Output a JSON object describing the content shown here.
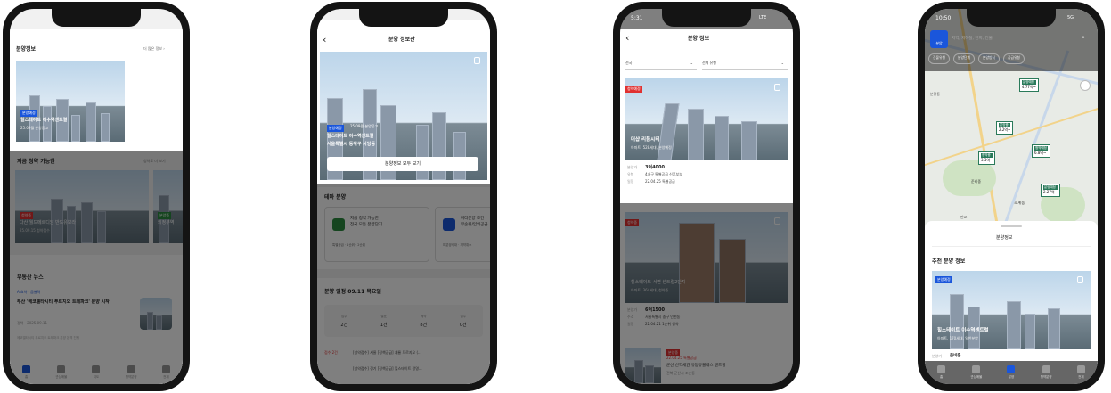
{
  "phone1": {
    "section_title": "분양정보",
    "more_link": "더 많은 정보",
    "hero": {
      "badge": "분양예정",
      "title": "힐스테이트 이수역센트럴",
      "date": "25.09월 분양공고"
    },
    "available": {
      "title": "지금 청약 가능한",
      "more": "청약도 더 보기",
      "card1": {
        "badge": "청약중",
        "title": "다산 월드메르디앙 반도유보라",
        "date": "25.09.15 청약접수"
      },
      "card2": {
        "badge": "분양중",
        "title": "의정부역"
      }
    },
    "news": {
      "title": "부동산 뉴스",
      "source": "AI요약 · 금별력",
      "headline": "부산 '에코델타시티 푸르지오 트레파크' 분양 시작",
      "meta": "정책 · 2025.09.11",
      "body": "에코델타시티 푸르지오 트레파크 분양 본격 진행"
    },
    "tabs": [
      "홈",
      "관심매물",
      "지도",
      "청약분양",
      "전체"
    ]
  },
  "phone2": {
    "header_title": "분양 정보관",
    "hero": {
      "badge1": "분양예정",
      "badge2": "25.09월 분양공고",
      "title": "힐스테이트 이수역센트럴",
      "subtitle": "서울특별시 동작구 사당동",
      "button": "분양정보 모두 보기"
    },
    "theme": {
      "title": "테마 분양",
      "card1": {
        "line1": "지금 청약 가능한",
        "line2": "전국 모든 분양단지",
        "tags": "특별공급 · 1순위 · 2순위"
      },
      "card2": {
        "line1": "미디분양 조건",
        "line2": "무순위/임의공급",
        "tags": "미분양세대 · 계약취소"
      }
    },
    "schedule": {
      "title": "분양 일정",
      "date": "09.11 목요일",
      "cols": [
        {
          "label": "접수",
          "value": "2건"
        },
        {
          "label": "발표",
          "value": "1건"
        },
        {
          "label": "계약",
          "value": "8건"
        },
        {
          "label": "입주",
          "value": "0건"
        }
      ]
    },
    "rows": [
      {
        "tag": "접수 2건",
        "text": "[청약접수] 서울 [정책공급] 계룡 푸르지오 (..."
      },
      {
        "tag": "",
        "text": "[청약접수] 경기 [정책공급] 힐스테이트 광명..."
      }
    ]
  },
  "phone3": {
    "status_time": "5:31",
    "status_right": "LTE",
    "header_title": "분양 정보",
    "filter1": "전국",
    "filter2": "전체 유형",
    "card1": {
      "badge": "청약예정",
      "title": "더샵 리듬시티",
      "sub": "아파트, 528세대, 분양예정",
      "price_label": "분양가",
      "price": "3억4000",
      "type_label": "유형",
      "type": "4가구 특별공급 신혼부부",
      "date_label": "일정",
      "date": "22.04.25 특별공급"
    },
    "card2": {
      "badge": "청약중",
      "title": "힐스테이트 서면 센트럴2단지",
      "sub": "아파트, 364세대, 청약중",
      "price_label": "분양가",
      "price": "6억1500",
      "type_label": "주소",
      "type": "서울특별시 중구 인현동",
      "date_label": "일정",
      "date": "22.04.21 1순위 청약"
    },
    "card3": {
      "badge": "분양중",
      "date_badge": "22.04.25 특별공급",
      "title": "군산 신역세권 유탑유블레스 센트럴",
      "sub": "전북 군산시 조촌동"
    }
  },
  "phone4": {
    "status_time": "10:50",
    "status_right": "5G",
    "search_tab": "분양",
    "search_placeholder": "지역, 지하철, 단지, 건물",
    "filters": [
      "건물유형",
      "분양단계",
      "분양방식",
      "공급유형"
    ],
    "map_places": [
      "분당동",
      "준비중",
      "호계동",
      "판교"
    ],
    "pins": [
      {
        "tag": "분양예정",
        "value": "4.77억~"
      },
      {
        "tag": "분양중",
        "value": "2.2억~"
      },
      {
        "tag": "청약예정",
        "value": "6.8억~"
      },
      {
        "tag": "분양예정",
        "value": "2.27억~"
      },
      {
        "tag": "청약중",
        "value": "3.3억~"
      }
    ],
    "sheet_title": "분양정보",
    "rec_title": "추천 분양 정보",
    "rec_badge": "분양예정",
    "rec_name": "힐스테이트 이수역센트럴",
    "rec_sub": "아파트, 170세대, 일반분양",
    "rec_price_label": "분양가",
    "rec_price": "준비중",
    "tabs": [
      "홈",
      "관심매물",
      "분양",
      "청약분양",
      "전체"
    ]
  },
  "colors": {
    "accent": "#1a56db",
    "badge_red": "#e03131",
    "badge_green": "#2b8a3e",
    "dim": "rgba(0,0,0,0.5)",
    "frame": "#141414"
  }
}
